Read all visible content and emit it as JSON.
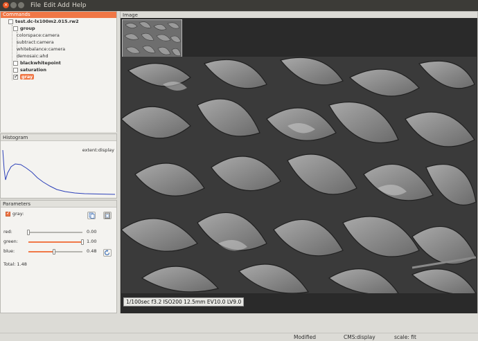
{
  "window": {
    "menus": [
      "File",
      "Edit",
      "Add",
      "Help"
    ]
  },
  "commands": {
    "title": "Commands",
    "root": "test.dc-lx100m2.015.rw2",
    "group": "group",
    "group_items": [
      "colorspace:camera",
      "subtract:camera",
      "whitebalance:camera",
      "demosaic:ahd"
    ],
    "items": [
      "blackwhitepoint",
      "saturation",
      "gray"
    ],
    "selected": "gray"
  },
  "histogram": {
    "title": "Histogram",
    "extent_label": "extent:display",
    "curve_color": "#2b3fb8"
  },
  "parameters": {
    "title": "Parameters",
    "module": "gray:",
    "sliders": [
      {
        "label": "red:",
        "value": "0.00",
        "fraction": 0.0
      },
      {
        "label": "green:",
        "value": "1.00",
        "fraction": 1.0
      },
      {
        "label": "blue:",
        "value": "0.48",
        "fraction": 0.48
      }
    ],
    "total": "Total: 1.48"
  },
  "image": {
    "title": "Image",
    "exif": "1/100sec  f3.2  ISO200  12.5mm  EV10.0 LV9.0"
  },
  "statusbar": {
    "modified": "Modified",
    "cms": "CMS:display",
    "scale": "scale: fit"
  },
  "colors": {
    "accent": "#f07746",
    "menubar": "#3c3b37"
  }
}
